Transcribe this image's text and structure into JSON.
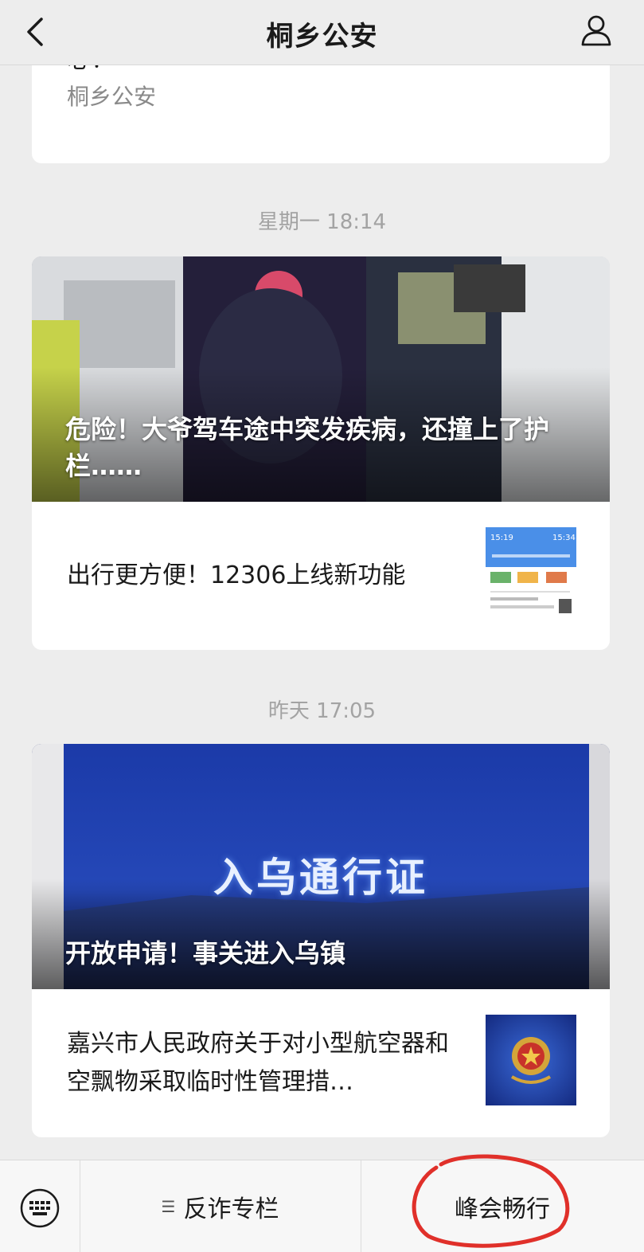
{
  "header": {
    "title": "桐乡公安"
  },
  "top_card": {
    "cut_text": "心！",
    "source": "桐乡公安"
  },
  "groups": [
    {
      "timestamp": "星期一 18:14",
      "hero_title": "危险！大爷驾车途中突发疾病，还撞上了护栏……",
      "sub_title": "出行更方便！12306上线新功能"
    },
    {
      "timestamp": "昨天 17:05",
      "hero_overlay": "入乌通行证",
      "hero_title": "开放申请！事关进入乌镇",
      "sub_title": "嘉兴市人民政府关于对小型航空器和空飘物采取临时性管理措…"
    }
  ],
  "thumb1": {
    "time_left": "15:19",
    "time_right": "15:34"
  },
  "bottom_menu": {
    "menu1": "反诈专栏",
    "menu2": "峰会畅行"
  },
  "colors": {
    "background": "#ededed",
    "card": "#ffffff",
    "annotation": "#e0302a"
  }
}
